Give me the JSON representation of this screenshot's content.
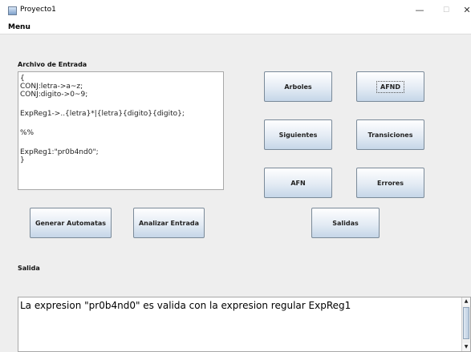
{
  "window": {
    "title": "Proyecto1",
    "minimize_glyph": "—",
    "maximize_glyph": "☐",
    "close_glyph": "✕"
  },
  "menubar": {
    "items": [
      {
        "label": "Menu"
      }
    ]
  },
  "input_section": {
    "label": "Archivo de Entrada",
    "lines": [
      "{",
      "CONJ:letra->a~z;",
      "CONJ:digito->0~9;",
      "",
      "ExpReg1->..{letra}*|{letra}{digito}{digito};",
      "",
      "%%",
      "",
      "ExpReg1:\"pr0b4nd0\";",
      "}"
    ]
  },
  "buttons": {
    "arboles": "Arboles",
    "afnd": "AFND",
    "siguientes": "Siguientes",
    "transiciones": "Transiciones",
    "afn": "AFN",
    "errores": "Errores",
    "generar_automatas": "Generar Automatas",
    "analizar_entrada": "Analizar Entrada",
    "salidas": "Salidas"
  },
  "output_section": {
    "label": "Salida",
    "text": "La expresion \"pr0b4nd0\" es valida con la expresion regular ExpReg1"
  }
}
